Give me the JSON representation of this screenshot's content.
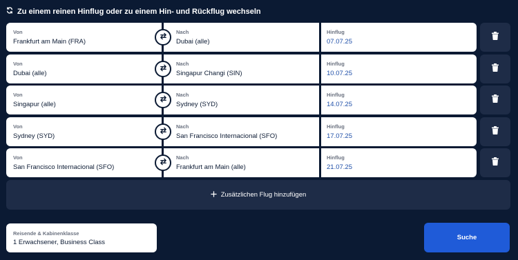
{
  "toggle": {
    "label": "Zu einem reinen Hinflug oder zu einem Hin- und Rückflug wechseln",
    "icon": "swap-circular-icon"
  },
  "legs": [
    {
      "from_label": "Von",
      "from": "Frankfurt am Main (FRA)",
      "to_label": "Nach",
      "to": "Dubai (alle)",
      "date_label": "Hinflug",
      "date": "07.07.25"
    },
    {
      "from_label": "Von",
      "from": "Dubai (alle)",
      "to_label": "Nach",
      "to": "Singapur Changi (SIN)",
      "date_label": "Hinflug",
      "date": "10.07.25"
    },
    {
      "from_label": "Von",
      "from": "Singapur (alle)",
      "to_label": "Nach",
      "to": "Sydney (SYD)",
      "date_label": "Hinflug",
      "date": "14.07.25"
    },
    {
      "from_label": "Von",
      "from": "Sydney (SYD)",
      "to_label": "Nach",
      "to": "San Francisco Internacional (SFO)",
      "date_label": "Hinflug",
      "date": "17.07.25"
    },
    {
      "from_label": "Von",
      "from": "San Francisco Internacional (SFO)",
      "to_label": "Nach",
      "to": "Frankfurt am Main (alle)",
      "date_label": "Hinflug",
      "date": "21.07.25"
    }
  ],
  "add_flight": {
    "label": "Zusätzlichen Flug hinzufügen",
    "icon": "plus-icon"
  },
  "travellers": {
    "label": "Reisende & Kabinenklasse",
    "value": "1 Erwachsener, Business Class"
  },
  "search": {
    "label": "Suche"
  },
  "colors": {
    "background": "#0b1a33",
    "card": "#ffffff",
    "secondary_button": "#1e2c47",
    "accent": "#1f5bd8",
    "date_text": "#1f4fa8"
  }
}
